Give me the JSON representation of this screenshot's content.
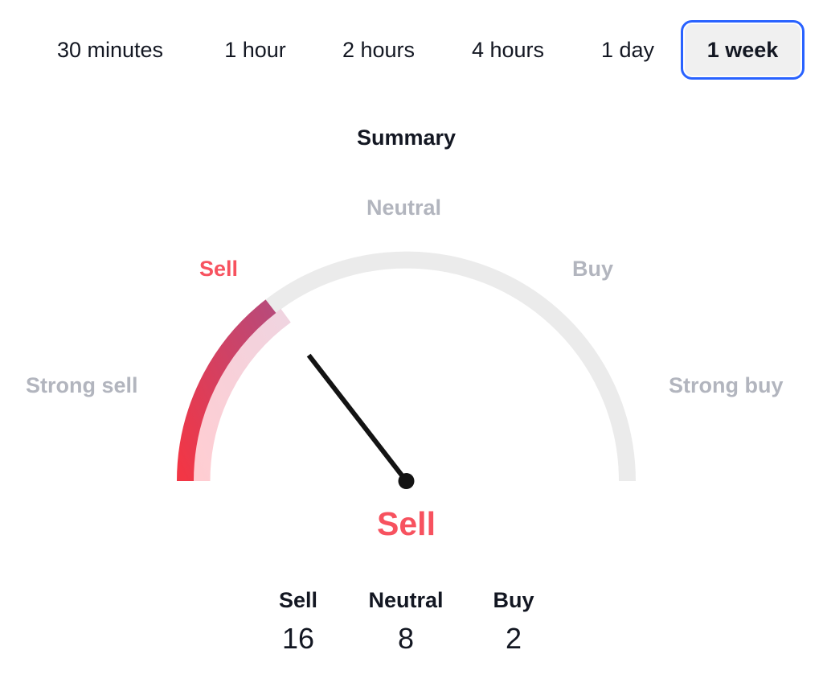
{
  "timeframes": {
    "items": [
      {
        "label": "30 minutes",
        "active": false
      },
      {
        "label": "1 hour",
        "active": false
      },
      {
        "label": "2 hours",
        "active": false
      },
      {
        "label": "4 hours",
        "active": false
      },
      {
        "label": "1 day",
        "active": false
      },
      {
        "label": "1 week",
        "active": true
      }
    ]
  },
  "summary": {
    "title": "Summary",
    "scale_labels": {
      "strong_sell": "Strong sell",
      "sell": "Sell",
      "neutral": "Neutral",
      "buy": "Buy",
      "strong_buy": "Strong buy"
    },
    "active_zone": "sell",
    "result": "Sell",
    "counts": [
      {
        "label": "Sell",
        "value": "16"
      },
      {
        "label": "Neutral",
        "value": "8"
      },
      {
        "label": "Buy",
        "value": "2"
      }
    ]
  },
  "chart_data": {
    "type": "gauge",
    "title": "Summary",
    "scale": [
      "Strong sell",
      "Sell",
      "Neutral",
      "Buy",
      "Strong buy"
    ],
    "range": [
      -1,
      1
    ],
    "value": -0.42,
    "reading": "Sell",
    "counts": {
      "Sell": 16,
      "Neutral": 8,
      "Buy": 2
    }
  },
  "colors": {
    "accent": "#2962ff",
    "sell": "#f7525f",
    "sell_gradient_start": "#f23645",
    "sell_gradient_end": "#b84a7a",
    "sell_band_light_start": "#ffcdd2",
    "sell_band_light_end": "#f0d4e0",
    "track": "#ebebeb",
    "label_muted": "#b2b5be",
    "needle": "#131313",
    "text": "#131722"
  }
}
